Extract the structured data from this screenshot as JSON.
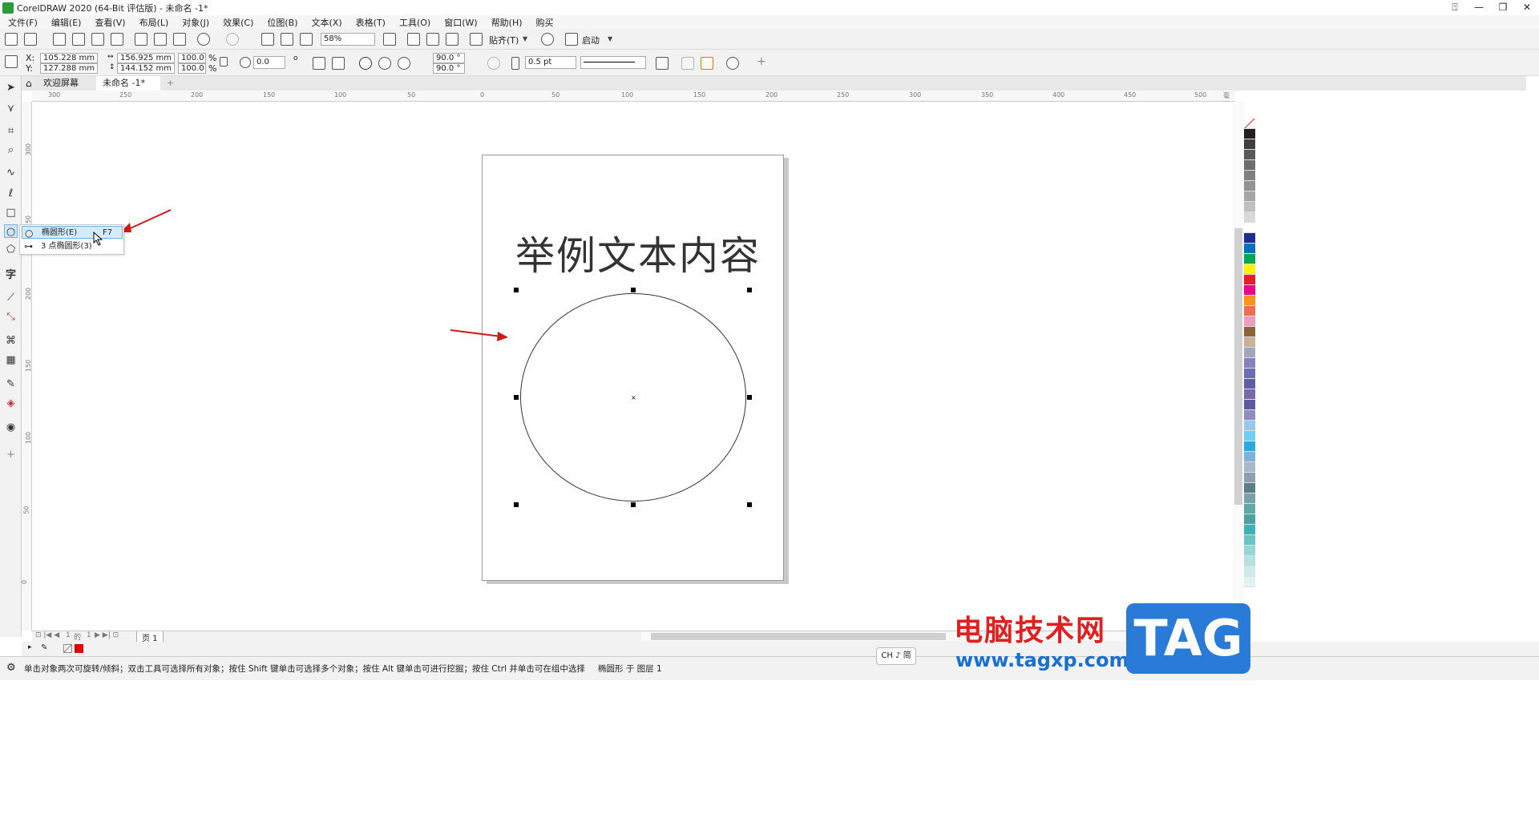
{
  "window": {
    "title": "CorelDRAW 2020 (64-Bit 评估版) - 未命名 -1*"
  },
  "menu": [
    "文件(F)",
    "编辑(E)",
    "查看(V)",
    "布局(L)",
    "对象(J)",
    "效果(C)",
    "位图(B)",
    "文本(X)",
    "表格(T)",
    "工具(O)",
    "窗口(W)",
    "帮助(H)",
    "购买"
  ],
  "toolbar": {
    "zoom": "58%",
    "snap_label": "贴齐(T)",
    "launch_label": "启动"
  },
  "property_bar": {
    "x_label": "X:",
    "x_value": "105.228 mm",
    "y_label": "Y:",
    "y_value": "127.288 mm",
    "width_value": "156.925 mm",
    "height_value": "144.152 mm",
    "scale_x": "100.0",
    "scale_y": "100.0",
    "percent": "%",
    "rotation": "0.0",
    "degree": "o",
    "start_angle": "90.0 °",
    "end_angle": "90.0 °",
    "outline_width": "0.5 pt"
  },
  "tabs": [
    {
      "label": "欢迎屏幕"
    },
    {
      "label": "未命名 -1*"
    },
    {
      "label": "+"
    }
  ],
  "ruler_h": [
    "300",
    "250",
    "200",
    "150",
    "100",
    "50",
    "0",
    "50",
    "100",
    "150",
    "200",
    "250",
    "300",
    "350",
    "400",
    "450",
    "500",
    "毫米"
  ],
  "ruler_v": [
    "300",
    "250",
    "200",
    "150",
    "100",
    "50",
    "0"
  ],
  "canvas": {
    "sample_text": "举例文本内容"
  },
  "flyout": [
    {
      "label": "椭圆形(E)",
      "shortcut": "F7"
    },
    {
      "label": "3 点椭圆形(3)",
      "shortcut": ""
    }
  ],
  "page_nav": {
    "current": "1",
    "of": "的",
    "total": "1",
    "page_tab": "页 1"
  },
  "status": {
    "hint": "单击对象两次可旋转/倾斜；双击工具可选择所有对象；按住 Shift 键单击可选择多个对象；按住 Alt 键单击可进行挖掘；按住 Ctrl 并单击可在组中选择",
    "layer": "椭圆形 于 图层 1",
    "ime": "CH ♪ 简"
  },
  "palette": [
    "#ffffff",
    "#231f20",
    "#404040",
    "#595959",
    "#6d6d6d",
    "#808080",
    "#939393",
    "#a6a6a6",
    "#bfbfbf",
    "#d9d9d9",
    "#ffffff",
    "#1f2d8e",
    "#0072bc",
    "#00a651",
    "#fff200",
    "#ed1c24",
    "#ec008c",
    "#f7941d",
    "#f26c4f",
    "#f49ac1",
    "#8c6239",
    "#c7b299",
    "#a3a3c2",
    "#8781bd",
    "#6a6fb3",
    "#605ca8",
    "#7b68a9",
    "#5c5a9e",
    "#8e8cc0",
    "#9ac6e8",
    "#6dcff6",
    "#29abe2",
    "#7fb3d5",
    "#a7b8c8",
    "#8ca0b3",
    "#5f7c8a",
    "#79a1a6",
    "#5fa8a8",
    "#4aa3a3",
    "#3fb2b2",
    "#6cc5c5",
    "#9ad4d4",
    "#b7e1e1",
    "#cfeaea",
    "#e0f2f2"
  ],
  "watermark": {
    "cn": "电脑技术网",
    "url": "www.tagxp.com",
    "tag": "TAG"
  }
}
